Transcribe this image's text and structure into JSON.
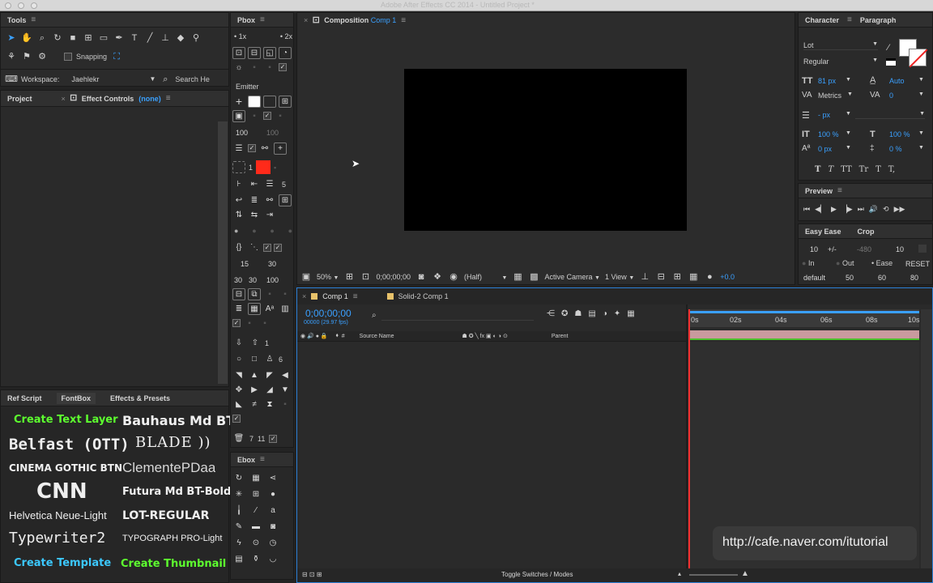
{
  "titlebar": {
    "text": "Adobe After Effects CC 2014 - Untitled Project *"
  },
  "tools": {
    "title": "Tools",
    "snapping": "Snapping",
    "workspace_label": "Workspace:",
    "workspace_value": "Jaehlekr",
    "search_placeholder": "Search He"
  },
  "project_panel": {
    "tab_project": "Project",
    "tab_effect_prefix": "Effect Controls",
    "tab_effect_target": "(none)"
  },
  "pbox": {
    "title": "Pbox",
    "zoom_1x": "1x",
    "zoom_2x": "2x",
    "emitter": "Emitter",
    "val_100a": "100",
    "val_100b": "100",
    "val_1": "1",
    "val_5": "5",
    "val_15": "15",
    "val_30a": "30",
    "val_30b": "30",
    "val_30c": "30",
    "val_100c": "100",
    "val_1b": "1",
    "val_6": "6",
    "val_7": "7",
    "val_11": "11",
    "accent_color": "#ff2a1a"
  },
  "ebox": {
    "title": "Ebox"
  },
  "composition": {
    "tab_prefix": "Composition",
    "tab_name": "Comp 1",
    "zoom": "50%",
    "timecode": "0;00;00;00",
    "resolution": "(Half)",
    "camera": "Active Camera",
    "views": "1 View",
    "exposure": "+0.0"
  },
  "character": {
    "tab_character": "Character",
    "tab_paragraph": "Paragraph",
    "font": "Lot",
    "style": "Regular",
    "size": "81 px",
    "leading": "Auto",
    "kerning": "Metrics",
    "tracking": "0",
    "stroke": "- px",
    "vscale": "100 %",
    "hscale": "100 %",
    "baseline": "0 px",
    "tsume": "0 %",
    "format_buttons": [
      "T",
      "T",
      "TT",
      "Tr",
      "T",
      "T,"
    ]
  },
  "preview": {
    "title": "Preview"
  },
  "easyease": {
    "tab_easy": "Easy Ease",
    "tab_crop": "Crop",
    "v10a": "10",
    "pm": "+/-",
    "v480": "-480",
    "v10b": "10",
    "opt_in": "In",
    "opt_out": "Out",
    "opt_ease": "Ease",
    "reset": "RESET",
    "default": "default",
    "d50": "50",
    "d60": "60",
    "d80": "80"
  },
  "timeline": {
    "tab1": "Comp 1",
    "tab2": "Solid-2 Comp 1",
    "timecode": "0;00;00;00",
    "fps": "00000 (29.97 fps)",
    "col_source": "Source Name",
    "col_parent": "Parent",
    "ruler": [
      "0s",
      "02s",
      "04s",
      "06s",
      "08s",
      "10s"
    ],
    "toggle": "Toggle Switches / Modes"
  },
  "scripts": {
    "tab_ref": "Ref Script",
    "tab_fontbox": "FontBox",
    "tab_effects": "Effects & Presets",
    "fonts": [
      "Create Text Layer",
      "Bauhaus Md BT",
      "Belfast (OTT)",
      "BLADE ))",
      "CINEMA GOTHIC BTN",
      "ClementePDaa",
      "CNN",
      "Futura Md BT-Bold",
      "Helvetica Neue-Light",
      "LOT-REGULAR",
      "Typewriter2",
      "TYPOGRAPH PRO-Light",
      "Create Template",
      "Create Thumbnail"
    ]
  },
  "watermark": "http://cafe.naver.com/itutorial"
}
